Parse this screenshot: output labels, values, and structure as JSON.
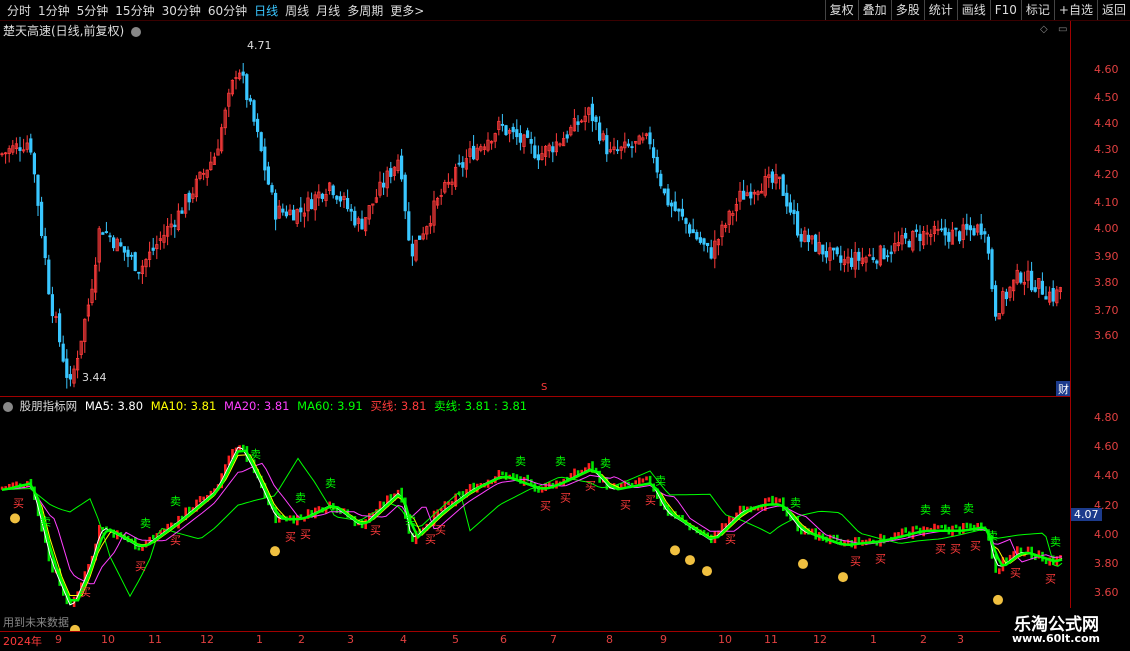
{
  "toolbar": {
    "periods": [
      "分时",
      "1分钟",
      "5分钟",
      "15分钟",
      "30分钟",
      "60分钟",
      "日线",
      "周线",
      "月线",
      "多周期",
      "更多"
    ],
    "more_arrow": ">",
    "active_period": "日线",
    "right_buttons": [
      "复权",
      "叠加",
      "多股",
      "统计",
      "画线",
      "F10",
      "标记",
      "+自选",
      "返回"
    ]
  },
  "main_panel": {
    "title": "楚天高速(日线,前复权)",
    "high_label": "4.71",
    "low_label": "3.44",
    "y_ticks": [
      "4.60",
      "4.50",
      "4.40",
      "4.30",
      "4.20",
      "4.10",
      "4.00",
      "3.90",
      "3.80",
      "3.70",
      "3.60"
    ],
    "marker_s": "S",
    "marker_cai": "财"
  },
  "indicator_panel": {
    "name": "股朋指标网",
    "ma5": "MA5: 3.80",
    "ma10": "MA10: 3.81",
    "ma20": "MA20: 3.81",
    "ma60": "MA60: 3.91",
    "buy_line": "买线: 3.81",
    "sell_line": "卖线: 3.81",
    "extra": ": 3.81",
    "current_price": "4.07",
    "y_ticks": [
      "4.80",
      "4.60",
      "4.40",
      "4.20",
      "4.00",
      "3.80",
      "3.60"
    ],
    "buy_mark": "买",
    "sell_mark": "卖",
    "footer_note": "用到未来数据"
  },
  "x_axis": {
    "year_label": "2024年",
    "months": [
      "9",
      "10",
      "11",
      "12",
      "1",
      "2",
      "3",
      "4",
      "5",
      "6",
      "7",
      "8",
      "9",
      "10",
      "11",
      "12",
      "1",
      "2",
      "3"
    ]
  },
  "watermark": {
    "line1": "乐淘公式网",
    "line2": "www.60lt.com"
  },
  "colors": {
    "up": "#ff3b3b",
    "down": "#39c6ff",
    "ma5": "#ffffff",
    "ma10": "#ffff00",
    "ma20": "#ff40ff",
    "ma60": "#00ff00",
    "axis": "#a00000"
  }
}
